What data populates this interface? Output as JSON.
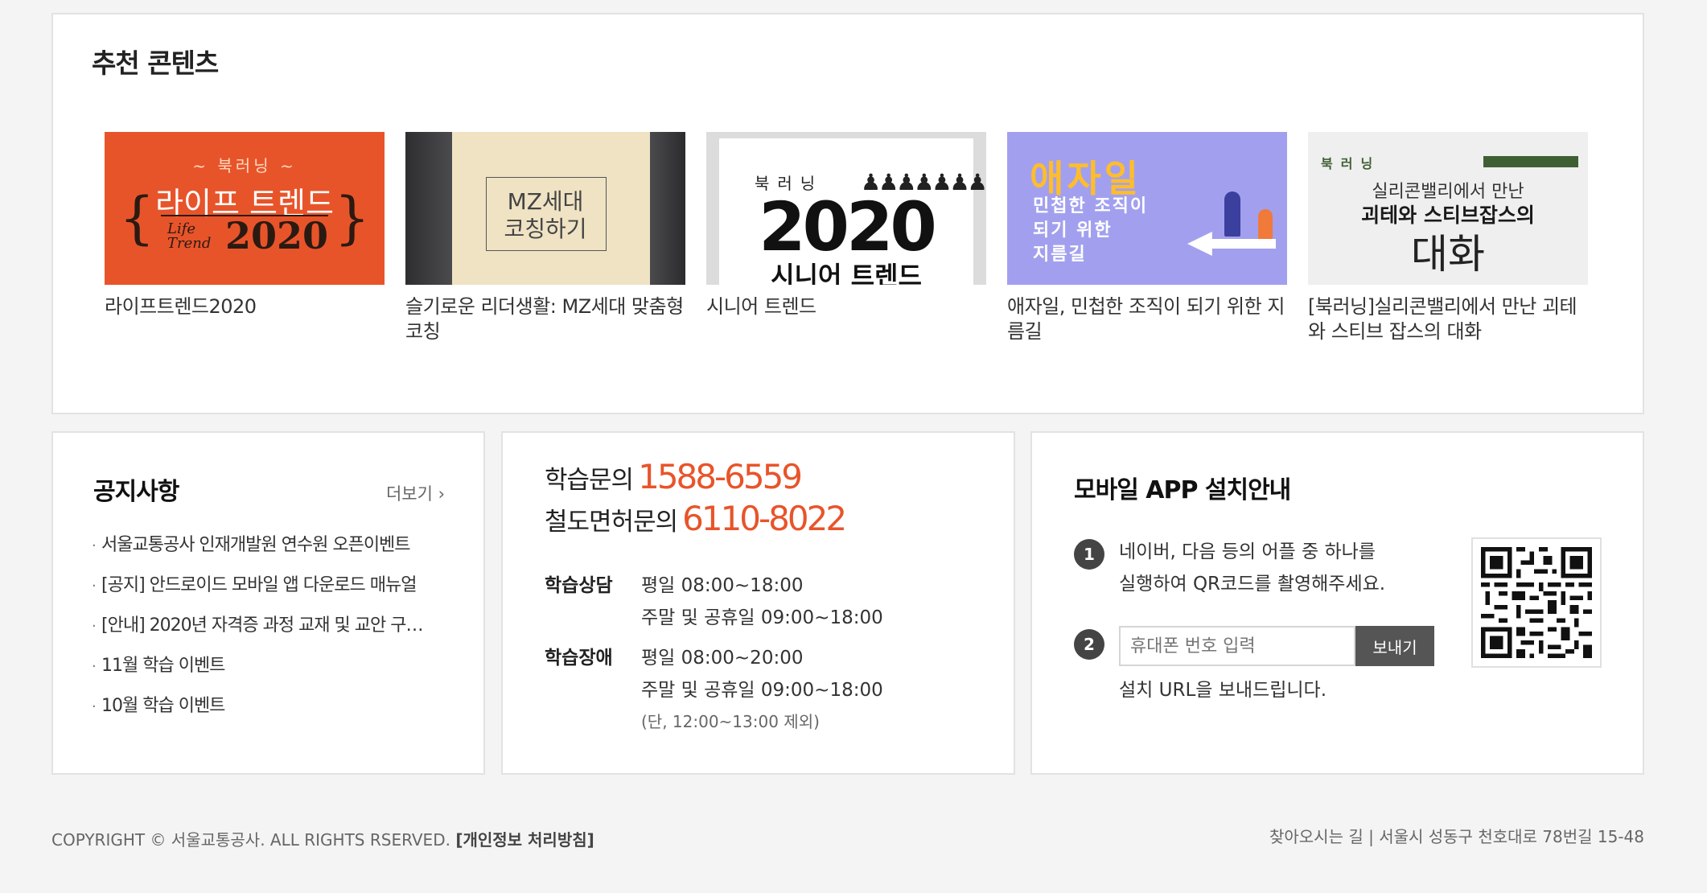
{
  "recommended": {
    "title": "추천 콘텐츠",
    "cards": [
      {
        "caption": "라이프트렌드2020",
        "thumb_top": "~ 북러닝 ~",
        "thumb_main": "라이프 트렌드",
        "thumb_sub": "Life Trend",
        "thumb_year": "2020"
      },
      {
        "caption": "슬기로운 리더생활: MZ세대 맞춤형 코칭",
        "thumb_line1": "MZ세대",
        "thumb_line2": "코칭하기"
      },
      {
        "caption": "시니어 트렌드",
        "thumb_top": "북러닝",
        "thumb_year": "2020",
        "thumb_bottom": "시니어 트렌드"
      },
      {
        "caption": "애자일, 민첩한 조직이 되기 위한 지름길",
        "thumb_title": "애자일",
        "thumb_line1": "민첩한 조직이",
        "thumb_line2": "되기 위한",
        "thumb_line3": "지름길"
      },
      {
        "caption": "[북러닝]실리콘밸리에서 만난 괴테와 스티브 잡스의 대화",
        "thumb_top": "북러닝",
        "thumb_line1": "실리콘밸리에서 만난",
        "thumb_line2": "괴테와 스티브잡스의",
        "thumb_line3": "대화"
      }
    ]
  },
  "notice": {
    "title": "공지사항",
    "more": "더보기",
    "items": [
      "서울교통공사 인재개발원 연수원 오픈이벤트",
      "[공지] 안드로이드 모바일 앱 다운로드 매뉴얼",
      "[안내] 2020년 자격증 과정 교재 및 교안 구…",
      "11월 학습 이벤트",
      "10월 학습 이벤트"
    ]
  },
  "contact": {
    "learn_label": "학습문의",
    "learn_number": "1588-6559",
    "rail_label": "철도면허문의",
    "rail_number": "6110-8022",
    "consult_label": "학습상담",
    "consult_weekday": "평일 08:00~18:00",
    "consult_weekend": "주말 및 공휴일 09:00~18:00",
    "issue_label": "학습장애",
    "issue_weekday": "평일 08:00~20:00",
    "issue_weekend": "주말 및 공휴일 09:00~18:00",
    "issue_note": "(단, 12:00~13:00 제외)"
  },
  "app": {
    "title": "모바일 APP 설치안내",
    "step1_num": "1",
    "step1_line1": "네이버, 다음 등의 어플 중 하나를",
    "step1_line2": "실행하여 QR코드를 촬영해주세요.",
    "step2_num": "2",
    "phone_placeholder": "휴대폰 번호 입력",
    "send_label": "보내기",
    "step2_text": "설치 URL을 보내드립니다."
  },
  "footer": {
    "copyright": "COPYRIGHT © 서울교통공사. ALL RIGHTS RSERVED.",
    "privacy": "[개인정보 처리방침]",
    "directions_label": "찾아오시는 길",
    "separator": "|",
    "address": "서울시 성동구 천호대로 78번길 15-48"
  },
  "colors": {
    "accent": "#e8542a",
    "dark_button": "#555555",
    "border": "#e2e2e2"
  }
}
